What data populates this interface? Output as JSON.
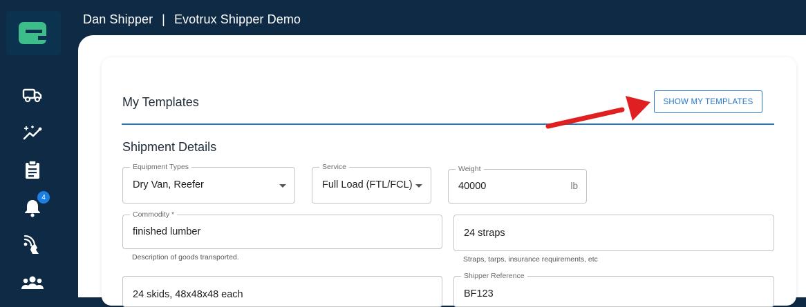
{
  "header": {
    "user_name": "Dan Shipper",
    "separator": "|",
    "company": "Evotrux Shipper Demo"
  },
  "sidebar": {
    "logo_letter": "e",
    "items": [
      {
        "icon": "truck-icon"
      },
      {
        "icon": "analytics-icon"
      },
      {
        "icon": "clipboard-icon"
      },
      {
        "icon": "bell-icon",
        "badge": "4"
      },
      {
        "icon": "tracking-icon"
      },
      {
        "icon": "users-icon"
      }
    ]
  },
  "templates": {
    "title": "My Templates",
    "button_label": "SHOW MY TEMPLATES"
  },
  "shipment": {
    "title": "Shipment Details",
    "equipment_types": {
      "label": "Equipment Types",
      "value": "Dry Van, Reefer"
    },
    "service": {
      "label": "Service",
      "value": "Full Load (FTL/FCL)"
    },
    "weight": {
      "label": "Weight",
      "value": "40000",
      "unit": "lb"
    },
    "commodity": {
      "label": "Commodity *",
      "value": "finished lumber",
      "helper": "Description of goods transported."
    },
    "requirements": {
      "value": "24 straps",
      "helper": "Straps, tarps, insurance requirements, etc"
    },
    "packaging": {
      "value": "24 skids, 48x48x48 each"
    },
    "shipper_reference": {
      "label": "Shipper Reference",
      "value": "BF123"
    }
  },
  "colors": {
    "sidebar": "#0f2a44",
    "accent": "#2775c9",
    "logo": "#3dbd8a",
    "annotation_arrow": "#e02020"
  }
}
